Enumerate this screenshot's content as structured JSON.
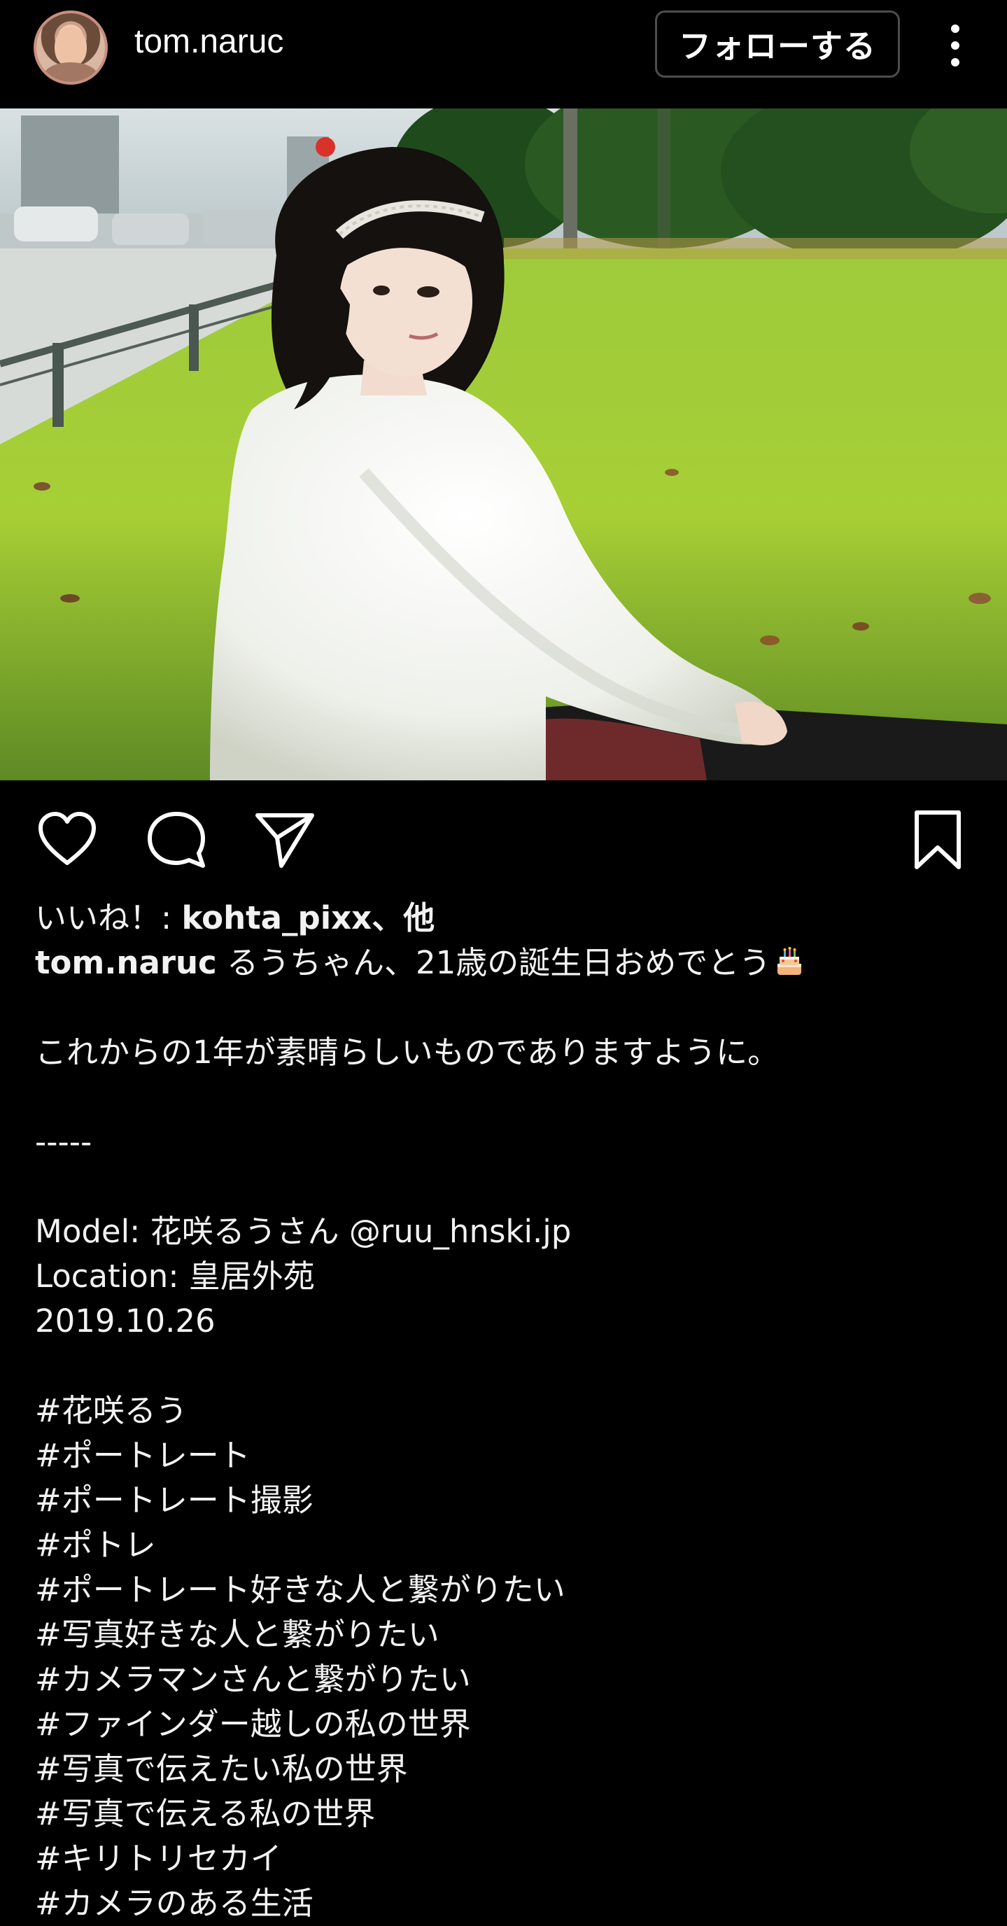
{
  "header": {
    "username": "tom.naruc",
    "follow_label": "フォローする",
    "avatar_icon": "avatar",
    "more_icon": "more-vertical-icon"
  },
  "actions": {
    "like_icon": "heart-icon",
    "comment_icon": "comment-icon",
    "share_icon": "send-icon",
    "save_icon": "bookmark-icon"
  },
  "likes": {
    "prefix": "いいね！: ",
    "user": "kohta_pixx",
    "suffix": "、他"
  },
  "caption": {
    "author": "tom.naruc",
    "first_line": " るうちゃん、21歳の誕生日おめでとう",
    "emoji": "birthday-cake-icon",
    "line2": "これからの1年が素晴らしいものでありますように。",
    "divider": "-----",
    "model": "Model: 花咲るうさん @ruu_hnski.jp",
    "location": "Location: 皇居外苑",
    "date": "2019.10.26",
    "hashtags": [
      "#花咲るう",
      "#ポートレート",
      "#ポートレート撮影",
      "#ポトレ",
      "#ポートレート好きな人と繋がりたい",
      "#写真好きな人と繋がりたい",
      "#カメラマンさんと繋がりたい",
      "#ファインダー越しの私の世界",
      "#写真で伝えたい私の世界",
      "#写真で伝える私の世界",
      "#キリトリセカイ",
      "#カメラのある生活"
    ]
  },
  "colors": {
    "background": "#000000",
    "text": "#f2f2f2",
    "button_border": "#4d4d4d"
  }
}
